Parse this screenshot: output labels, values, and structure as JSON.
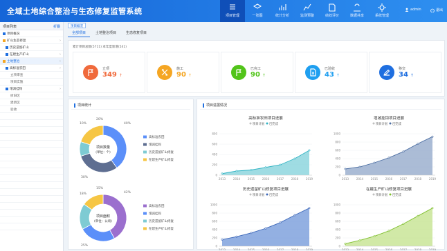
{
  "app_title": "全域土地综合整治与生态修复监管系统",
  "nav": [
    {
      "label": "项目管理",
      "active": true
    },
    {
      "label": "一张图",
      "active": false
    },
    {
      "label": "统计分析",
      "active": false
    },
    {
      "label": "监测预警",
      "active": false
    },
    {
      "label": "绩效评价",
      "active": false
    },
    {
      "label": "数据共享",
      "active": false
    },
    {
      "label": "系统管理",
      "active": false
    }
  ],
  "user": "admin",
  "logout": "退出",
  "sidebar": {
    "title": "项目列表",
    "action": "折叠",
    "rows": [
      {
        "text": "项目概况",
        "level": 0,
        "icon": "#1f6fe0",
        "arrow": false,
        "hl": false
      },
      {
        "text": "矿山生态修复",
        "level": 0,
        "icon": "#f5a623",
        "arrow": true,
        "hl": false
      },
      {
        "text": "历史遗留矿山",
        "level": 1,
        "icon": "#1f6fe0",
        "arrow": false,
        "hl": false
      },
      {
        "text": "在建生产矿山",
        "level": 1,
        "icon": "#1f6fe0",
        "arrow": true,
        "hl": false
      },
      {
        "text": "土地整治",
        "level": 0,
        "icon": "#f5a623",
        "arrow": true,
        "hl": true
      },
      {
        "text": "高标准农田",
        "level": 1,
        "icon": "#1f6fe0",
        "arrow": true,
        "hl": false
      },
      {
        "text": "立项审查",
        "level": 2,
        "icon": "",
        "arrow": false,
        "hl": false
      },
      {
        "text": "项目实施",
        "level": 2,
        "icon": "",
        "arrow": false,
        "hl": false
      },
      {
        "text": "增减挂钩",
        "level": 1,
        "icon": "#1f6fe0",
        "arrow": true,
        "hl": false
      },
      {
        "text": "拆旧区",
        "level": 2,
        "icon": "",
        "arrow": false,
        "hl": false
      },
      {
        "text": "建新区",
        "level": 2,
        "icon": "",
        "arrow": false,
        "hl": false
      },
      {
        "text": "验收",
        "level": 2,
        "icon": "",
        "arrow": false,
        "hl": false
      }
    ]
  },
  "breadcrumb": "项目概况",
  "tabs": [
    {
      "label": "全部项目",
      "active": true
    },
    {
      "label": "土地整治项目",
      "active": false
    },
    {
      "label": "生态修复项目",
      "active": false
    }
  ],
  "stat_caption": "累计项目总数(5711) 本年度新增(541)",
  "stat_cards": [
    {
      "label": "立项",
      "value": "349",
      "color": "#f06a3c",
      "icon": "flag",
      "arrow": "↑"
    },
    {
      "label": "施工",
      "value": "90",
      "color": "#f5a623",
      "icon": "tools",
      "arrow": "↑"
    },
    {
      "label": "已完工",
      "value": "90",
      "color": "#52c41a",
      "icon": "flag",
      "arrow": "↑"
    },
    {
      "label": "已验收",
      "value": "43",
      "color": "#1f9ff0",
      "icon": "doc",
      "arrow": "↑"
    },
    {
      "label": "移交",
      "value": "34",
      "color": "#1f6fe0",
      "icon": "pen",
      "arrow": "↑"
    }
  ],
  "left_panel_title": "项目统计",
  "right_panel_title": "项目进展情况",
  "chart_data": [
    {
      "type": "pie",
      "donut_label": [
        "项目数量",
        "(单位：个)"
      ],
      "categories": [
        "高标准农田",
        "增减挂钩",
        "历史遗留矿山修复",
        "在建生产矿山修复"
      ],
      "values": [
        40,
        30,
        10,
        20
      ],
      "slice_labels": [
        "40%",
        "30%",
        "10%",
        "20%"
      ],
      "colors": [
        "#5b8ff9",
        "#5e6e91",
        "#7ecbd3",
        "#f6c644"
      ]
    },
    {
      "type": "pie",
      "donut_label": [
        "项目面积",
        "(单位：公顷)"
      ],
      "categories": [
        "高标准农田",
        "增减挂钩",
        "历史遗留矿山修复",
        "在建生产矿山修复"
      ],
      "values": [
        42,
        25,
        18,
        15
      ],
      "slice_labels": [
        "42%",
        "25%",
        "18%",
        "15%"
      ],
      "colors": [
        "#9b6fce",
        "#5b8ff9",
        "#7ecbd3",
        "#f6c644"
      ]
    },
    {
      "type": "area",
      "title": "高标准农田项目进展",
      "legend": [
        "项目计划",
        "已完成"
      ],
      "x": [
        "2013",
        "2014",
        "2015",
        "2016",
        "2017",
        "2018",
        "2019"
      ],
      "ylim": [
        0,
        800
      ],
      "yticks": [
        "800",
        "600",
        "400",
        "200",
        "0"
      ],
      "series": [
        {
          "name": "项目计划",
          "values": [
            40,
            90,
            110,
            160,
            215,
            340,
            520
          ]
        },
        {
          "name": "已完成",
          "values": [
            30,
            80,
            100,
            150,
            200,
            320,
            480
          ]
        }
      ],
      "fill": "#7fd0d9",
      "line": "#2fb3c3"
    },
    {
      "type": "area",
      "title": "增减挂钩项目进展",
      "legend": [
        "项目计划",
        "已完成"
      ],
      "x": [
        "2013",
        "2014",
        "2015",
        "2016",
        "2017",
        "2018",
        "2019"
      ],
      "ylim": [
        0,
        1000
      ],
      "yticks": [
        "1000",
        "800",
        "600",
        "400",
        "200",
        "0"
      ],
      "series": [
        {
          "name": "项目计划",
          "values": [
            160,
            220,
            320,
            440,
            590,
            780,
            950
          ]
        },
        {
          "name": "已完成",
          "values": [
            150,
            200,
            300,
            420,
            570,
            760,
            930
          ]
        }
      ],
      "fill": "#8fa6c8",
      "line": "#4d6fa3"
    },
    {
      "type": "area",
      "title": "历史遗留矿山修复项目进展",
      "legend": [
        "项目计划",
        "已完成"
      ],
      "x": [
        "2013",
        "2014",
        "2015",
        "2016",
        "2017",
        "2018",
        "2019"
      ],
      "ylim": [
        0,
        1000
      ],
      "yticks": [
        "1000",
        "800",
        "600",
        "400",
        "200",
        "0"
      ],
      "series": [
        {
          "name": "项目计划",
          "values": [
            170,
            240,
            330,
            440,
            580,
            760,
            940
          ]
        },
        {
          "name": "已完成",
          "values": [
            160,
            230,
            320,
            430,
            570,
            750,
            920
          ]
        }
      ],
      "fill": "#6f95d8",
      "line": "#3b66b8"
    },
    {
      "type": "area",
      "title": "在建生产矿山修复项目进展",
      "legend": [
        "项目计划",
        "已完成"
      ],
      "x": [
        "2013",
        "2014",
        "2015",
        "2016",
        "2017",
        "2018",
        "2019"
      ],
      "ylim": [
        0,
        1000
      ],
      "yticks": [
        "1000",
        "800",
        "600",
        "400",
        "200",
        "0"
      ],
      "series": [
        {
          "name": "项目计划",
          "values": [
            80,
            160,
            260,
            390,
            560,
            750,
            940
          ]
        },
        {
          "name": "已完成",
          "values": [
            60,
            140,
            240,
            370,
            540,
            730,
            920
          ]
        }
      ],
      "fill": "#c2e28a",
      "line": "#7fbf2e"
    }
  ]
}
